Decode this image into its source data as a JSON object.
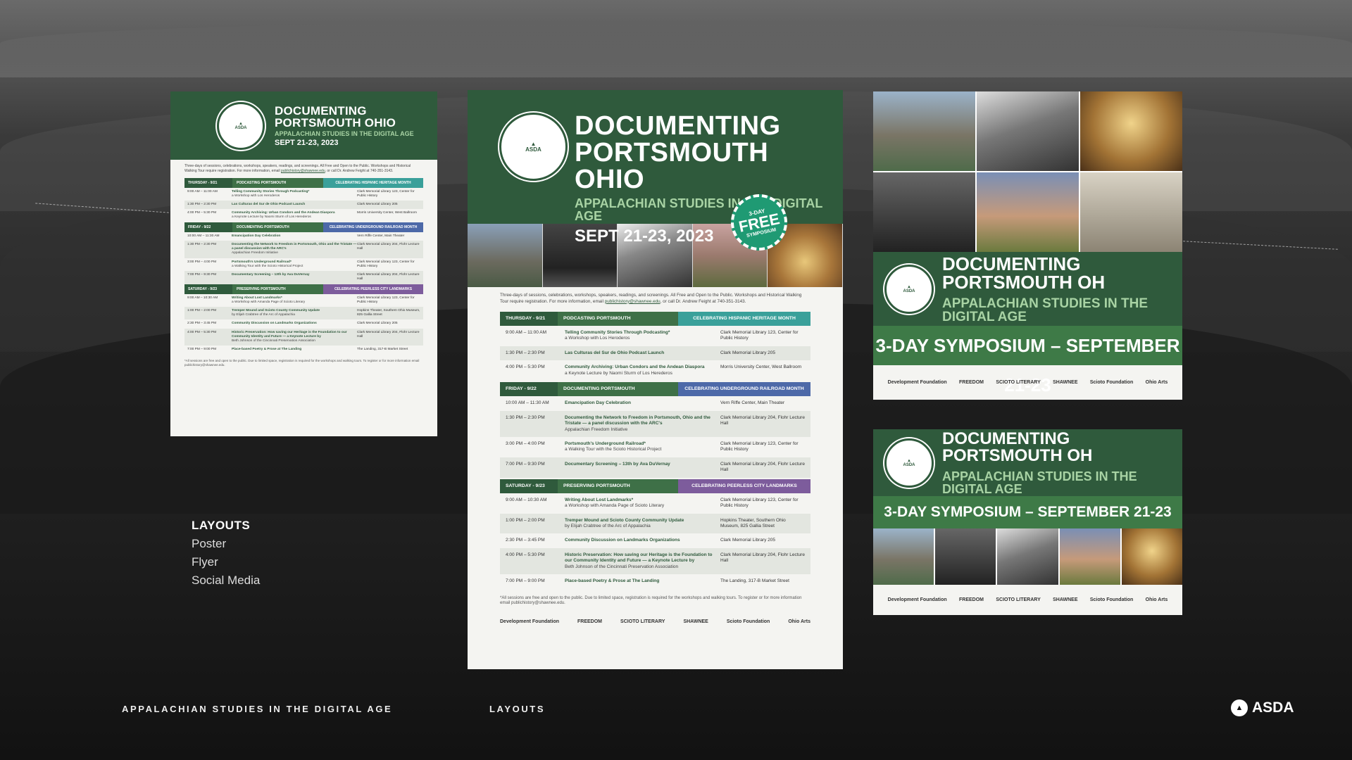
{
  "common": {
    "title_line1": "DOCUMENTING",
    "title_line2": "PORTSMOUTH OHIO",
    "subtitle": "APPALACHIAN STUDIES IN THE DIGITAL AGE",
    "dates_poster": "SEPT 21-23, 2023",
    "dates_flyer": "SEPT 21-23, 2023",
    "seal_text": "APPALACHIAN STUDIES IN THE DIGITAL AGE",
    "intro": "Three-days of sessions, celebrations, workshops, speakers, readings, and screenings. All Free and Open to the Public. Workshops and Historical Walking Tour require registration. For more information, email",
    "intro_email": "publichistory@shawnee.edu",
    "intro_tail": ", or call Dr. Andrew Feight at 740-351-3143.",
    "footnote": "*All sessions are free and open to the public. Due to limited space, registration is required for the workshops and walking tours. To register or for more information email publichistory@shawnee.edu."
  },
  "badge": {
    "line1": "3-DAY",
    "line2": "FREE",
    "line3": "SYMPOSIUM"
  },
  "days": [
    {
      "day": "THURSDAY - 9/21",
      "theme": "PODCASTING PORTSMOUTH",
      "celebration": "CELEBRATING HISPANIC HERITAGE MONTH",
      "color": "#3aa09a",
      "sessions": [
        {
          "time": "9:00 AM – 11:00 AM",
          "title": "Telling Community Stories Through Podcasting*",
          "sub": "a Workshop with Los Heroderos",
          "loc": "Clark Memorial Library 123, Center for Public History"
        },
        {
          "time": "1:30 PM – 2:30 PM",
          "title": "Las Culturas del Sur de Ohio Podcast Launch",
          "sub": "",
          "loc": "Clark Memorial Library 205"
        },
        {
          "time": "4:00 PM – 5:30 PM",
          "title": "Community Archiving: Urban Condors and the Andean Diaspora",
          "sub": "a Keynote Lecture by Naomi Sturm of Los Herederos",
          "loc": "Morris University Center, West Ballroom"
        }
      ]
    },
    {
      "day": "FRIDAY - 9/22",
      "theme": "DOCUMENTING PORTSMOUTH",
      "celebration": "CELEBRATING UNDERGROUND RAILROAD MONTH",
      "color": "#4d69a8",
      "sessions": [
        {
          "time": "10:00 AM – 11:30 AM",
          "title": "Emancipation Day Celebration",
          "sub": "",
          "loc": "Vern Riffe Center, Main Theater"
        },
        {
          "time": "1:30 PM – 2:30 PM",
          "title": "Documenting the Network to Freedom in Portsmouth, Ohio and the Tristate — a panel discussion with the ARC's",
          "sub": "Appalachian Freedom Initiative",
          "loc": "Clark Memorial Library 204, Flohr Lecture Hall"
        },
        {
          "time": "3:00 PM – 4:00 PM",
          "title": "Portsmouth's Underground Railroad*",
          "sub": "a Walking Tour with the Scioto Historical Project",
          "loc": "Clark Memorial Library 123, Center for Public History"
        },
        {
          "time": "7:00 PM – 9:30 PM",
          "title": "Documentary Screening – 13th by Ava DuVernay",
          "sub": "",
          "loc": "Clark Memorial Library 204, Flohr Lecture Hall"
        }
      ]
    },
    {
      "day": "SATURDAY - 9/23",
      "theme": "PRESERVING PORTSMOUTH",
      "celebration": "CELEBRATING PEERLESS CITY LANDMARKS",
      "color": "#7d5c9c",
      "sessions": [
        {
          "time": "9:00 AM – 10:30 AM",
          "title": "Writing About Lost Landmarks*",
          "sub": "a Workshop with Amanda Page of Scioto Literary",
          "loc": "Clark Memorial Library 123, Center for Public History"
        },
        {
          "time": "1:00 PM – 2:00 PM",
          "title": "Tremper Mound and Scioto County Community Update",
          "sub": "by Elijah Crabtree of the Arc of Appalachia",
          "loc": "Hopkins Theater, Southern Ohio Museum, 825 Gallia Street"
        },
        {
          "time": "2:30 PM – 3:45 PM",
          "title": "Community Discussion on Landmarks Organizations",
          "sub": "",
          "loc": "Clark Memorial Library 205"
        },
        {
          "time": "4:00 PM – 5:30 PM",
          "title": "Historic Preservation: How saving our Heritage is the Foundation to our Community Identity and Future — a Keynote Lecture by",
          "sub": "Beth Johnson of the Cincinnati Preservation Association",
          "loc": "Clark Memorial Library 204, Flohr Lecture Hall"
        },
        {
          "time": "7:00 PM – 9:00 PM",
          "title": "Place-based Poetry & Prose at The Landing",
          "sub": "",
          "loc": "The Landing, 317-B Market Street"
        }
      ]
    }
  ],
  "logos": [
    "Development Foundation",
    "FREEDOM",
    "SCIOTO LITERARY",
    "SHAWNEE",
    "Scioto Foundation",
    "Ohio Arts"
  ],
  "social": {
    "title": "DOCUMENTING PORTSMOUTH OH",
    "subtitle": "APPALACHIAN STUDIES IN THE DIGITAL AGE",
    "banner": "3-DAY SYMPOSIUM – SEPTEMBER  21-23"
  },
  "layouts_panel": {
    "heading": "LAYOUTS",
    "items": [
      "Poster",
      "Flyer",
      "Social Media"
    ]
  },
  "footer": {
    "left": "APPALACHIAN STUDIES IN THE DIGITAL AGE",
    "mid": "LAYOUTS",
    "brand": "ASDA"
  }
}
